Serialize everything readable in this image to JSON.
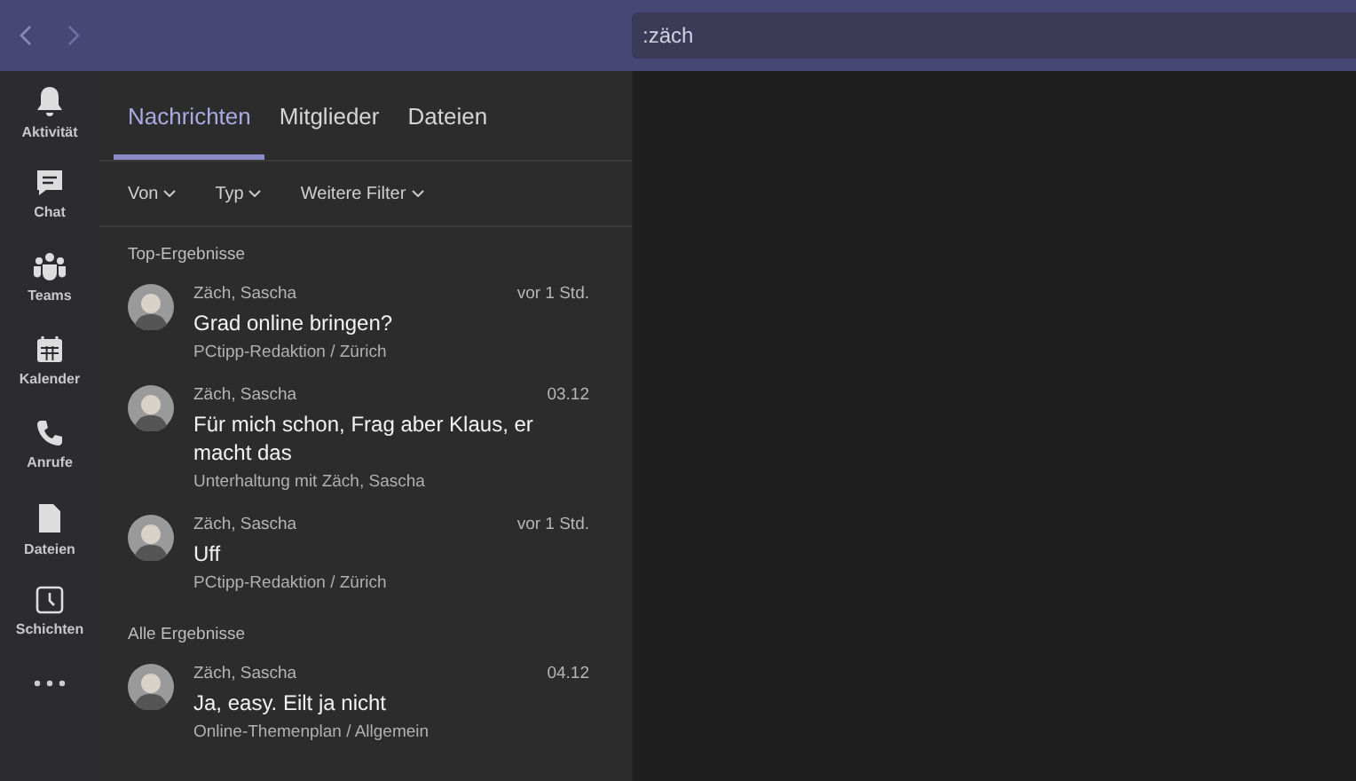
{
  "search": {
    "value": ":zäch"
  },
  "rail": [
    {
      "label": "Aktivität"
    },
    {
      "label": "Chat"
    },
    {
      "label": "Teams"
    },
    {
      "label": "Kalender"
    },
    {
      "label": "Anrufe"
    },
    {
      "label": "Dateien"
    },
    {
      "label": "Schichten"
    }
  ],
  "tabs": [
    {
      "label": "Nachrichten",
      "selected": true
    },
    {
      "label": "Mitglieder",
      "selected": false
    },
    {
      "label": "Dateien",
      "selected": false
    }
  ],
  "filters": [
    "Von",
    "Typ",
    "Weitere Filter"
  ],
  "sections": [
    {
      "title": "Top-Ergebnisse",
      "results": [
        {
          "sender": "Zäch, Sascha",
          "time": "vor 1 Std.",
          "message": "Grad online bringen?",
          "location": "PCtipp-Redaktion / Zürich"
        },
        {
          "sender": "Zäch, Sascha",
          "time": "03.12",
          "message": "Für mich schon, Frag aber Klaus, er macht das",
          "location": "Unterhaltung mit Zäch, Sascha"
        },
        {
          "sender": "Zäch, Sascha",
          "time": "vor 1 Std.",
          "message": "Uff",
          "location": "PCtipp-Redaktion / Zürich"
        }
      ]
    },
    {
      "title": "Alle Ergebnisse",
      "results": [
        {
          "sender": "Zäch, Sascha",
          "time": "04.12",
          "message": "Ja, easy. Eilt ja nicht",
          "location": "Online-Themenplan / Allgemein"
        }
      ]
    }
  ]
}
